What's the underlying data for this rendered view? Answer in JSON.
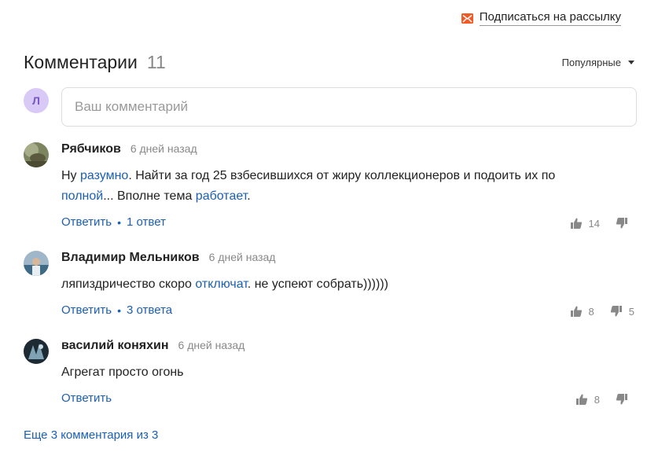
{
  "subscribe": {
    "label": "Подписаться на рассылку",
    "icon": "mail-icon",
    "icon_color": "#f15a24"
  },
  "header": {
    "title": "Комментарии",
    "count": "11",
    "sort_label": "Популярные"
  },
  "compose": {
    "avatar_letter": "Л",
    "placeholder": "Ваш комментарий"
  },
  "comments": [
    {
      "author": "Рябчиков",
      "time": "6 дней назад",
      "text_parts": [
        "Ну ",
        "разумно",
        ". Найти за год 25 взбесившихся от жиру коллекционеров и подоить их по ",
        "полной",
        "... Вполне тема ",
        "работает",
        "."
      ],
      "reply_label": "Ответить",
      "replies_label": "1 ответ",
      "likes": "14",
      "dislikes": ""
    },
    {
      "author": "Владимир Мельников",
      "time": "6 дней назад",
      "text_parts": [
        "ляпиздричество скоро ",
        "отключат",
        ". не успеют собрать))))))"
      ],
      "reply_label": "Ответить",
      "replies_label": "3 ответа",
      "likes": "8",
      "dislikes": "5"
    },
    {
      "author": "василий коняхин",
      "time": "6 дней назад",
      "text_parts": [
        "Агрегат просто огонь"
      ],
      "reply_label": "Ответить",
      "likes": "8",
      "dislikes": ""
    }
  ],
  "more_label": "Еще 3 комментария из 3",
  "colors": {
    "link": "#1a5fb4",
    "muted": "#888888",
    "accent": "#f15a24"
  }
}
